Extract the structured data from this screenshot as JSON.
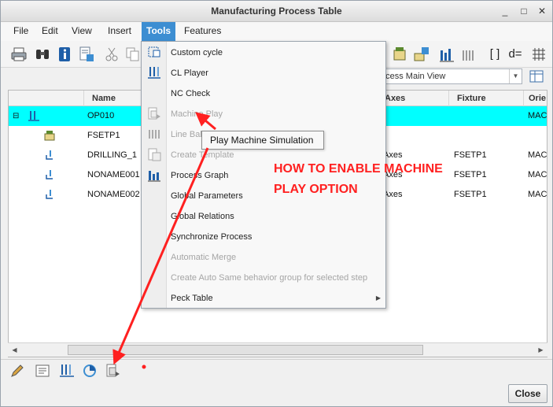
{
  "window": {
    "title": "Manufacturing Process Table",
    "controls": [
      "_",
      "□",
      "✕"
    ]
  },
  "menubar": {
    "items": [
      {
        "label": "File",
        "active": false
      },
      {
        "label": "Edit",
        "active": false
      },
      {
        "label": "View",
        "active": false
      },
      {
        "label": "Insert",
        "active": false
      },
      {
        "label": "Tools",
        "active": true
      },
      {
        "label": "Features",
        "active": false
      }
    ]
  },
  "toolbar": {
    "left_icons": [
      "print-icon",
      "find-icon",
      "info-icon",
      "properties-icon",
      "cut-icon",
      "copy-icon"
    ],
    "right_icons": [
      "fixture-icon",
      "workcell-icon",
      "chart-icon",
      "chart-gray-icon",
      "brackets-icon",
      "equals-icon",
      "grid-icon"
    ],
    "right_glyphs": [
      "[ ]",
      "d="
    ]
  },
  "view_select": {
    "value": "ocess Main View"
  },
  "table": {
    "columns": [
      "Name",
      "Axes",
      "Fixture",
      "Orie"
    ],
    "rows": [
      {
        "name": "OP010",
        "axes": "",
        "fixture": "",
        "orient": "MACH",
        "selected": true,
        "icon": "operation-icon",
        "expander": "⊟"
      },
      {
        "name": "FSETP1",
        "axes": "",
        "fixture": "",
        "orient": "",
        "selected": false,
        "icon": "fixture-setup-icon",
        "expander": ""
      },
      {
        "name": "DRILLING_1",
        "axes": "Axes",
        "fixture": "FSETP1",
        "orient": "MACH",
        "selected": false,
        "icon": "drill-step-icon",
        "expander": ""
      },
      {
        "name": "NONAME001",
        "axes": "Axes",
        "fixture": "FSETP1",
        "orient": "MACH",
        "selected": false,
        "icon": "drill-step-icon",
        "expander": ""
      },
      {
        "name": "NONAME002",
        "axes": "Axes",
        "fixture": "FSETP1",
        "orient": "MACH",
        "selected": false,
        "icon": "drill-step-icon",
        "expander": ""
      }
    ]
  },
  "tools_menu": {
    "items": [
      {
        "label": "Custom cycle",
        "disabled": false,
        "icon": "custom-cycle-icon",
        "submenu": false
      },
      {
        "label": "CL Player",
        "disabled": false,
        "icon": "cl-player-icon",
        "submenu": false
      },
      {
        "label": "NC Check",
        "disabled": false,
        "icon": "",
        "submenu": false
      },
      {
        "label": "Machine Play",
        "disabled": true,
        "icon": "machine-play-icon",
        "submenu": false
      },
      {
        "label": "Line Bala",
        "disabled": true,
        "icon": "line-balance-icon",
        "submenu": false
      },
      {
        "label": "Create Template",
        "disabled": true,
        "icon": "template-icon",
        "submenu": false
      },
      {
        "label": "Process Graph",
        "disabled": false,
        "icon": "process-graph-icon",
        "submenu": false
      },
      {
        "label": "Global Parameters",
        "disabled": false,
        "icon": "",
        "submenu": false
      },
      {
        "label": "Global Relations",
        "disabled": false,
        "icon": "",
        "submenu": false
      },
      {
        "label": "Synchronize Process",
        "disabled": false,
        "icon": "",
        "submenu": false
      },
      {
        "label": "Automatic Merge",
        "disabled": true,
        "icon": "",
        "submenu": false
      },
      {
        "label": "Create Auto Same behavior group for selected step",
        "disabled": true,
        "icon": "",
        "submenu": false
      },
      {
        "label": "Peck Table",
        "disabled": false,
        "icon": "",
        "submenu": true
      }
    ],
    "submenu_arrow": "▶"
  },
  "tooltip": {
    "text": "Play Machine Simulation"
  },
  "annotation": {
    "line1": "HOW TO ENABLE MACHINE",
    "line2": "PLAY OPTION",
    "color": "#ff2020"
  },
  "bottom_toolbar": {
    "icons": [
      "edit-pencil-icon",
      "notes-icon",
      "cl-player-icon",
      "process-graph-icon",
      "machine-play-icon"
    ]
  },
  "scroll_arrows": {
    "left": "◀",
    "right": "▶",
    "dropdown": "▼"
  },
  "buttons": {
    "close": "Close"
  },
  "colors": {
    "accent": "#3d8ed2",
    "selected_row": "#00ffff",
    "annotation_red": "#ff2020"
  }
}
